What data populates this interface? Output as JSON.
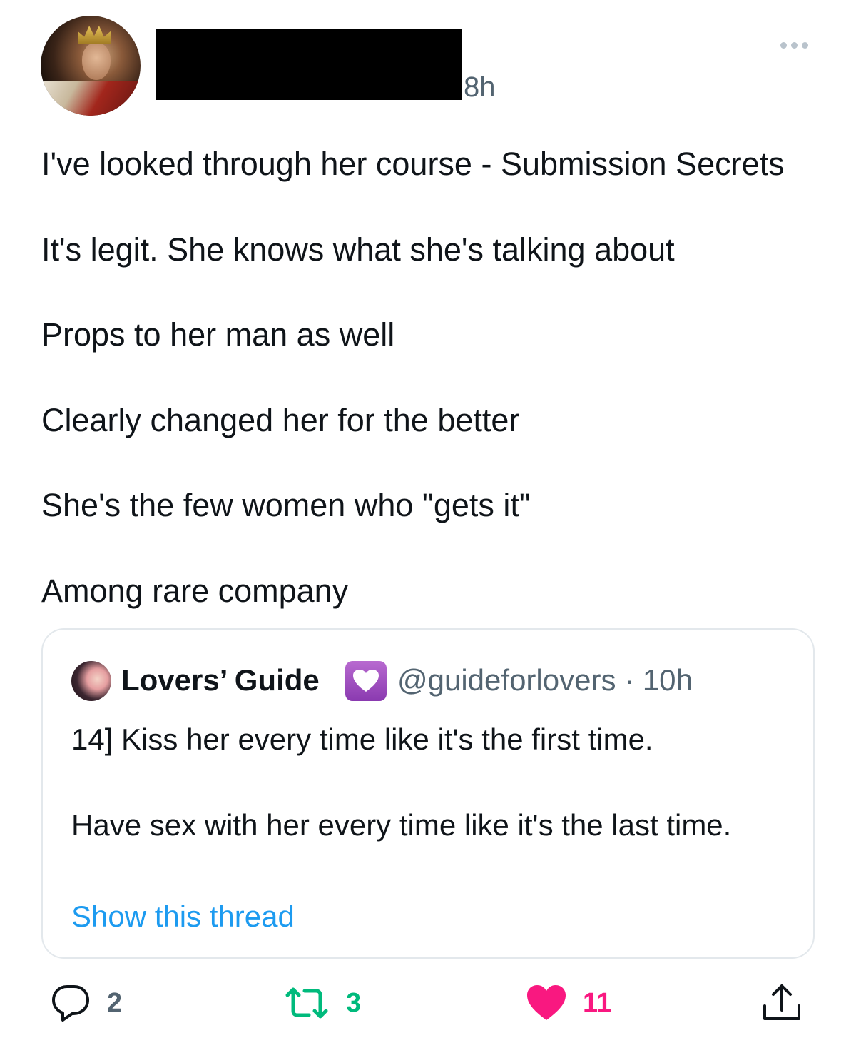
{
  "tweet": {
    "time": "8h",
    "lines": [
      "I've looked through her course - Submission Secrets",
      "It's legit. She knows what she's talking about",
      "Props to her man as well",
      "Clearly changed her for the better",
      "She's the few women who \"gets it\"",
      "Among rare company"
    ]
  },
  "quote": {
    "name": "Lovers’ Guide",
    "badge_icon": "purple-heart-icon",
    "handle_time": "@guideforlovers · 10h",
    "line1": "14] Kiss her every time like it's the first time.",
    "line2": "Have sex with her every time like it's the last time.",
    "link": "Show this thread"
  },
  "actions": {
    "replies": "2",
    "retweets": "3",
    "likes": "11"
  },
  "colors": {
    "retweet": "#00ba7c",
    "like": "#f91880",
    "link": "#1d9bf0",
    "secondary": "#536471"
  }
}
